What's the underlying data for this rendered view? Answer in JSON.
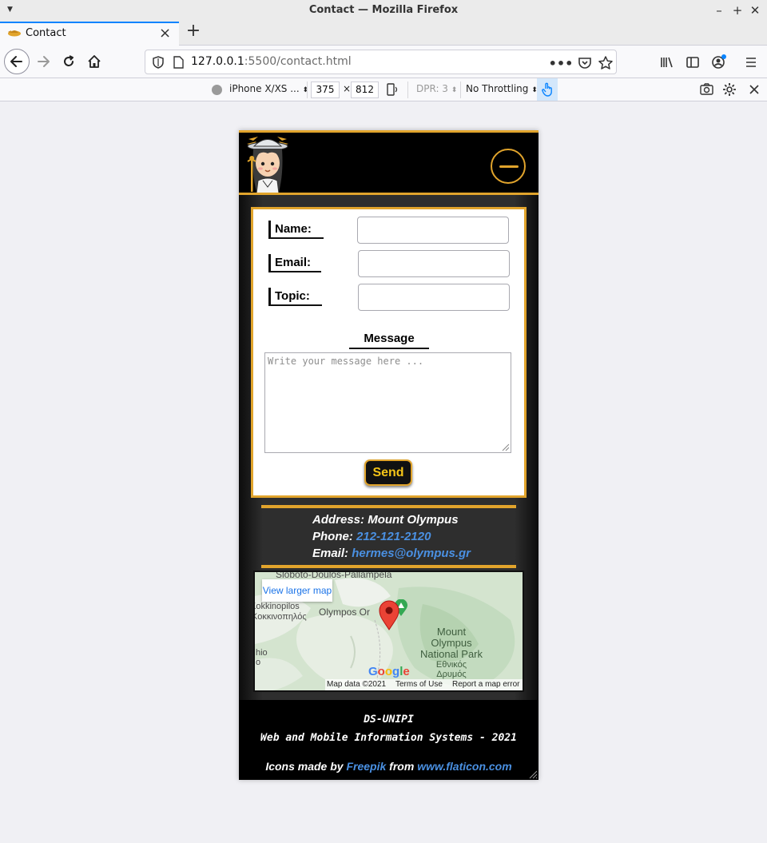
{
  "window": {
    "title": "Contact — Mozilla Firefox",
    "minimize_icon": "minimize-icon",
    "maximize_icon": "maximize-icon",
    "close_icon": "close-icon"
  },
  "tabs": [
    {
      "label": "Contact",
      "active": true
    }
  ],
  "toolbar": {
    "url_host": "127.0.0.1",
    "url_rest": ":5500/contact.html"
  },
  "rdm": {
    "device": "iPhone X/XS ...",
    "width": "375",
    "times": "×",
    "height": "812",
    "dpr": "DPR: 3",
    "throttling": "No Throttling"
  },
  "page": {
    "form": {
      "name_label": "Name:",
      "email_label": "Email:",
      "topic_label": "Topic:",
      "message_title": "Message",
      "message_placeholder": "Write your message here ...",
      "send_label": "Send"
    },
    "contact": {
      "address_label": "Address:",
      "address_value": "Mount Olympus",
      "phone_label": "Phone:",
      "phone_value": "212-121-2120",
      "email_label": "Email:",
      "email_value": "hermes@olympus.gr"
    },
    "map": {
      "view_larger": "View larger map",
      "place_top": "Sloboto-Doulos-Pallampela",
      "place_kokkino": "Kokkinopilos",
      "place_kokkino_gr": "Κοκκινοπηλός",
      "place_olympos": "Olympos Or",
      "park_line1": "Mount",
      "park_line2": "Olympus",
      "park_line3": "National Park",
      "park_gr1": "Εθνικός",
      "park_gr2": "Δρυμός",
      "place_hio": "hio",
      "place_hio2": "ο",
      "google": "Google",
      "map_data": "Map data ©2021",
      "terms": "Terms of Use",
      "report": "Report a map error"
    },
    "footer": {
      "line1": "DS-UNIPI",
      "line2": "Web and Mobile Information Systems - 2021",
      "icons_by": "Icons made by",
      "freepik": "Freepik",
      "from": "from",
      "flaticon": "www.flaticon.com"
    }
  },
  "colors": {
    "gold": "#e1a42c",
    "link_blue": "#4a90e2",
    "send_text": "#f5c518",
    "firefox_accent": "#0a84ff"
  }
}
